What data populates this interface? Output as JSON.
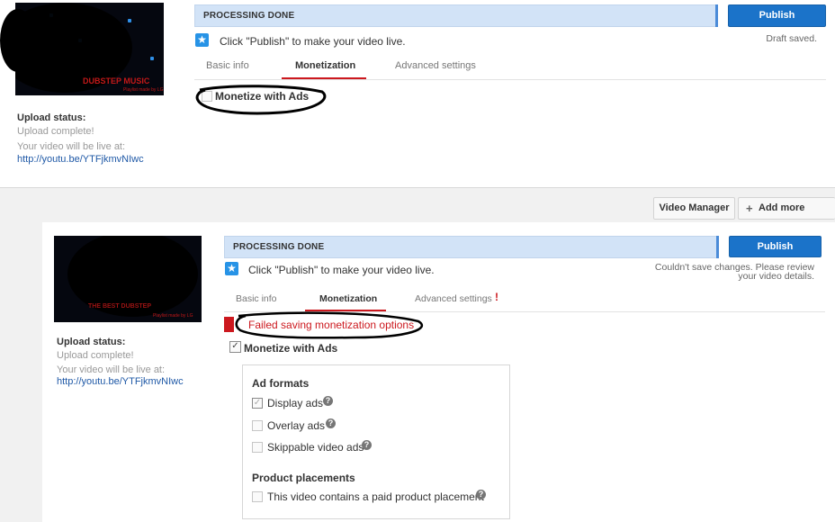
{
  "colors": {
    "accent": "#1b73c9",
    "error": "#cc181e",
    "status_bar": "#d2e3f7",
    "link": "#1e58a6"
  },
  "top": {
    "thumbnail": {
      "title": "DUBSTEP MUSIC",
      "subtitle": "Playlist made by LG"
    },
    "upload_status_label": "Upload status:",
    "upload_status_value": "Upload complete!",
    "live_label": "Your video will be live at:",
    "video_url": "http://youtu.be/YTFjkmvNIwc",
    "processing": "PROCESSING DONE",
    "publish_label": "Publish",
    "hint": "Click \"Publish\" to make your video live.",
    "save_note": "Draft saved.",
    "tabs": [
      {
        "label": "Basic info"
      },
      {
        "label": "Monetization"
      },
      {
        "label": "Advanced settings"
      }
    ],
    "monetize_label": "Monetize with Ads"
  },
  "toolbar": {
    "video_manager": "Video Manager",
    "add_more": "Add more videos"
  },
  "bottom": {
    "thumbnail": {
      "title": "THE BEST DUBSTEP",
      "subtitle": "Playlist made by LG"
    },
    "upload_status_label": "Upload status:",
    "upload_status_value": "Upload complete!",
    "live_label": "Your video will be live at:",
    "video_url": "http://youtu.be/YTFjkmvNIwc",
    "processing": "PROCESSING DONE",
    "publish_label": "Publish",
    "hint": "Click \"Publish\" to make your video live.",
    "save_note_line1": "Couldn't save changes. Please review",
    "save_note_line2": "your video details.",
    "tabs": [
      {
        "label": "Basic info"
      },
      {
        "label": "Monetization"
      },
      {
        "label": "Advanced settings"
      }
    ],
    "error_message": "Failed saving monetization options",
    "monetize_label": "Monetize with Ads",
    "ad_formats_heading": "Ad formats",
    "ad_formats": [
      {
        "label": "Display ads",
        "checked": true
      },
      {
        "label": "Overlay ads",
        "checked": false
      },
      {
        "label": "Skippable video ads",
        "checked": false
      }
    ],
    "product_placements_heading": "Product placements",
    "product_placement_label": "This video contains a paid product placement"
  }
}
